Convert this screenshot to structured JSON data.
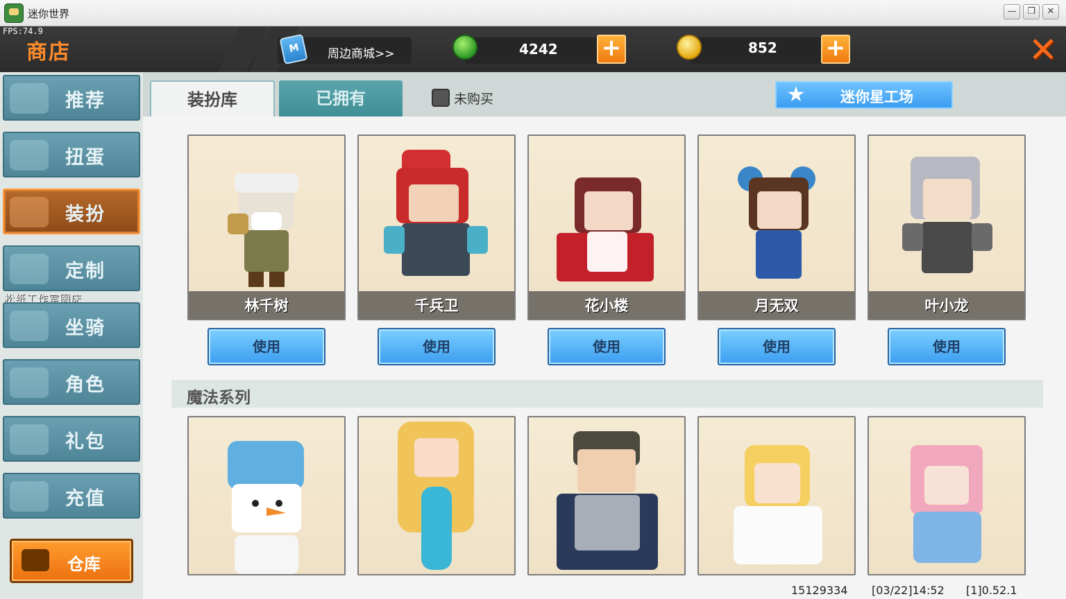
{
  "window": {
    "title": "迷你世界",
    "min": "—",
    "max": "❐",
    "close": "✕"
  },
  "fps": "FPS:74.9",
  "header": {
    "shop_title": "商店",
    "mall_link": "周边商城>>",
    "gems": "4242",
    "coins": "852",
    "plus": "+",
    "close": "✕"
  },
  "sidebar": {
    "items": [
      {
        "label": "推荐",
        "icon": "thumbs-up-icon"
      },
      {
        "label": "扭蛋",
        "icon": "capsule-icon"
      },
      {
        "label": "装扮",
        "icon": "shirt-icon",
        "active": true
      },
      {
        "label": "定制",
        "icon": "pencil-icon"
      },
      {
        "label": "坐骑",
        "icon": "mount-icon"
      },
      {
        "label": "角色",
        "icon": "character-icon"
      },
      {
        "label": "礼包",
        "icon": "gift-icon"
      },
      {
        "label": "充值",
        "icon": "coins-stack-icon"
      }
    ],
    "watermark": "松纸工作室图床",
    "warehouse": "仓库"
  },
  "tabs": {
    "wardrobe": "装扮库",
    "owned": "已拥有",
    "unbought": "未购买",
    "studio": "迷你星工场"
  },
  "skins": [
    {
      "name": "林千树",
      "use": "使用"
    },
    {
      "name": "千兵卫",
      "use": "使用"
    },
    {
      "name": "花小楼",
      "use": "使用"
    },
    {
      "name": "月无双",
      "use": "使用"
    },
    {
      "name": "叶小龙",
      "use": "使用"
    }
  ],
  "series": {
    "title": "魔法系列"
  },
  "status": {
    "uid": "15129334",
    "time": "[03/22]14:52",
    "version": "[1]0.52.1"
  },
  "colors": {
    "accent_orange": "#ff8b2a",
    "nav_blue": "#4e8597",
    "use_button": "#3c9df0"
  }
}
